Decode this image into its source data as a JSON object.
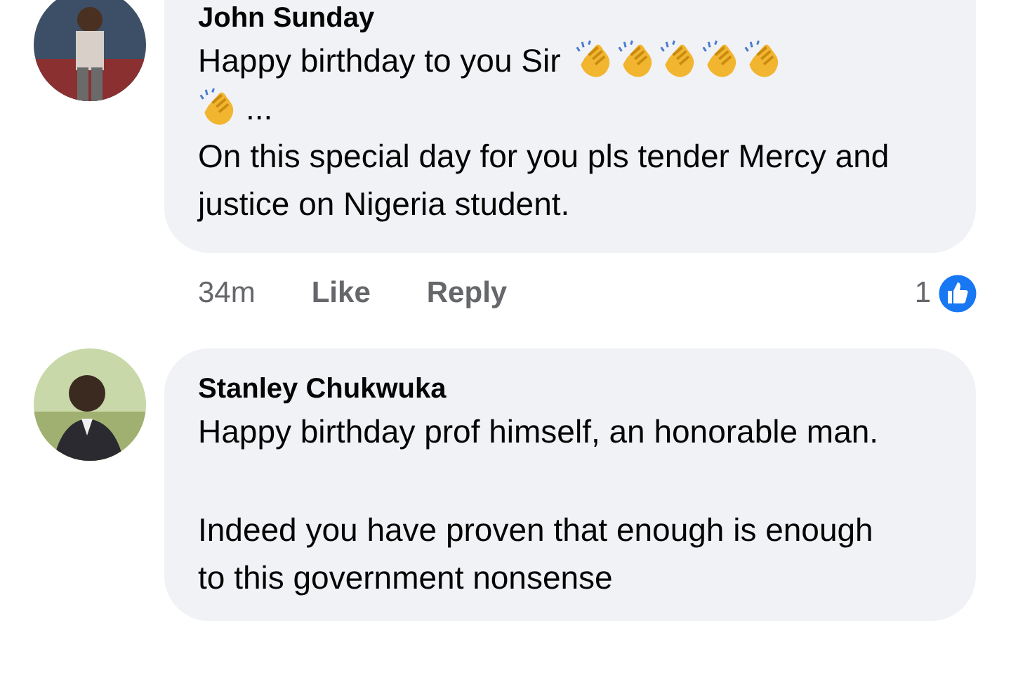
{
  "comments": [
    {
      "name": "John Sunday",
      "lines": [
        "Happy birthday to you Sir",
        "...",
        "On this special day for you pls tender Mercy and justice on Nigeria student."
      ],
      "time": "34m",
      "actions": [
        "Like",
        "Reply"
      ],
      "reactions": "1"
    },
    {
      "name": "Stanley Chukwuka",
      "paragraphs": [
        "Happy birthday prof himself, an honorable man.",
        "Indeed you have proven that enough is enough to this government nonsense"
      ]
    }
  ]
}
